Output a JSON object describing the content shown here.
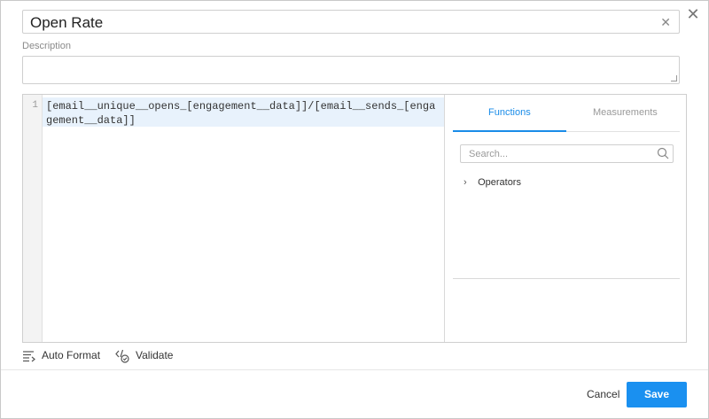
{
  "dialog": {
    "title_value": "Open Rate",
    "description_label": "Description",
    "description_value": ""
  },
  "editor": {
    "line_number": "1",
    "code": "[email__unique__opens_[engagement__data]]/[email__sends_[engagement__data]]"
  },
  "sidebar": {
    "tabs": [
      {
        "label": "Functions",
        "active": true
      },
      {
        "label": "Measurements",
        "active": false
      }
    ],
    "search_placeholder": "Search...",
    "tree": [
      {
        "label": "Operators",
        "expanded": false
      }
    ]
  },
  "toolbar": {
    "auto_format_label": "Auto Format",
    "validate_label": "Validate"
  },
  "footer": {
    "cancel_label": "Cancel",
    "save_label": "Save"
  },
  "colors": {
    "accent": "#1a90f0",
    "code_highlight": "#e8f2fc"
  },
  "icons": {
    "close": "close-icon",
    "clear": "clear-icon",
    "search": "search-icon",
    "chevron": "chevron-right-icon",
    "auto_format": "auto-format-icon",
    "validate": "validate-icon"
  }
}
